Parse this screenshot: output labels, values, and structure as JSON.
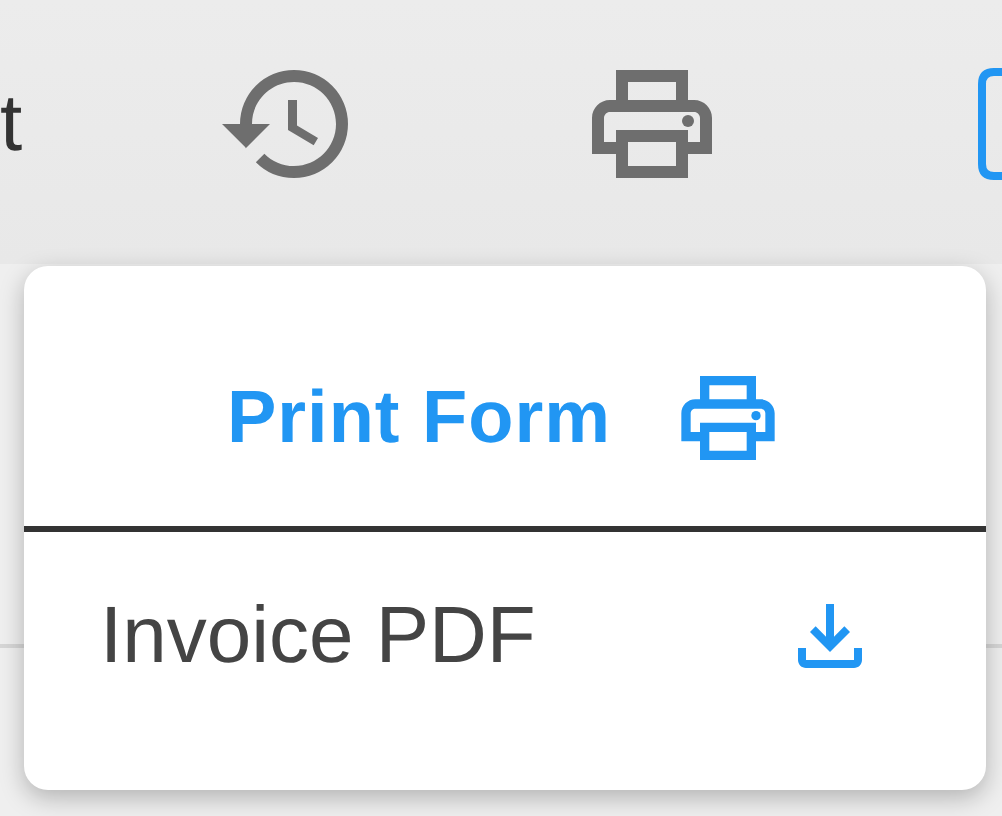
{
  "toolbar": {
    "partial_text": "t"
  },
  "menu": {
    "title": "Print Form",
    "items": [
      {
        "label": "Invoice PDF"
      }
    ]
  }
}
